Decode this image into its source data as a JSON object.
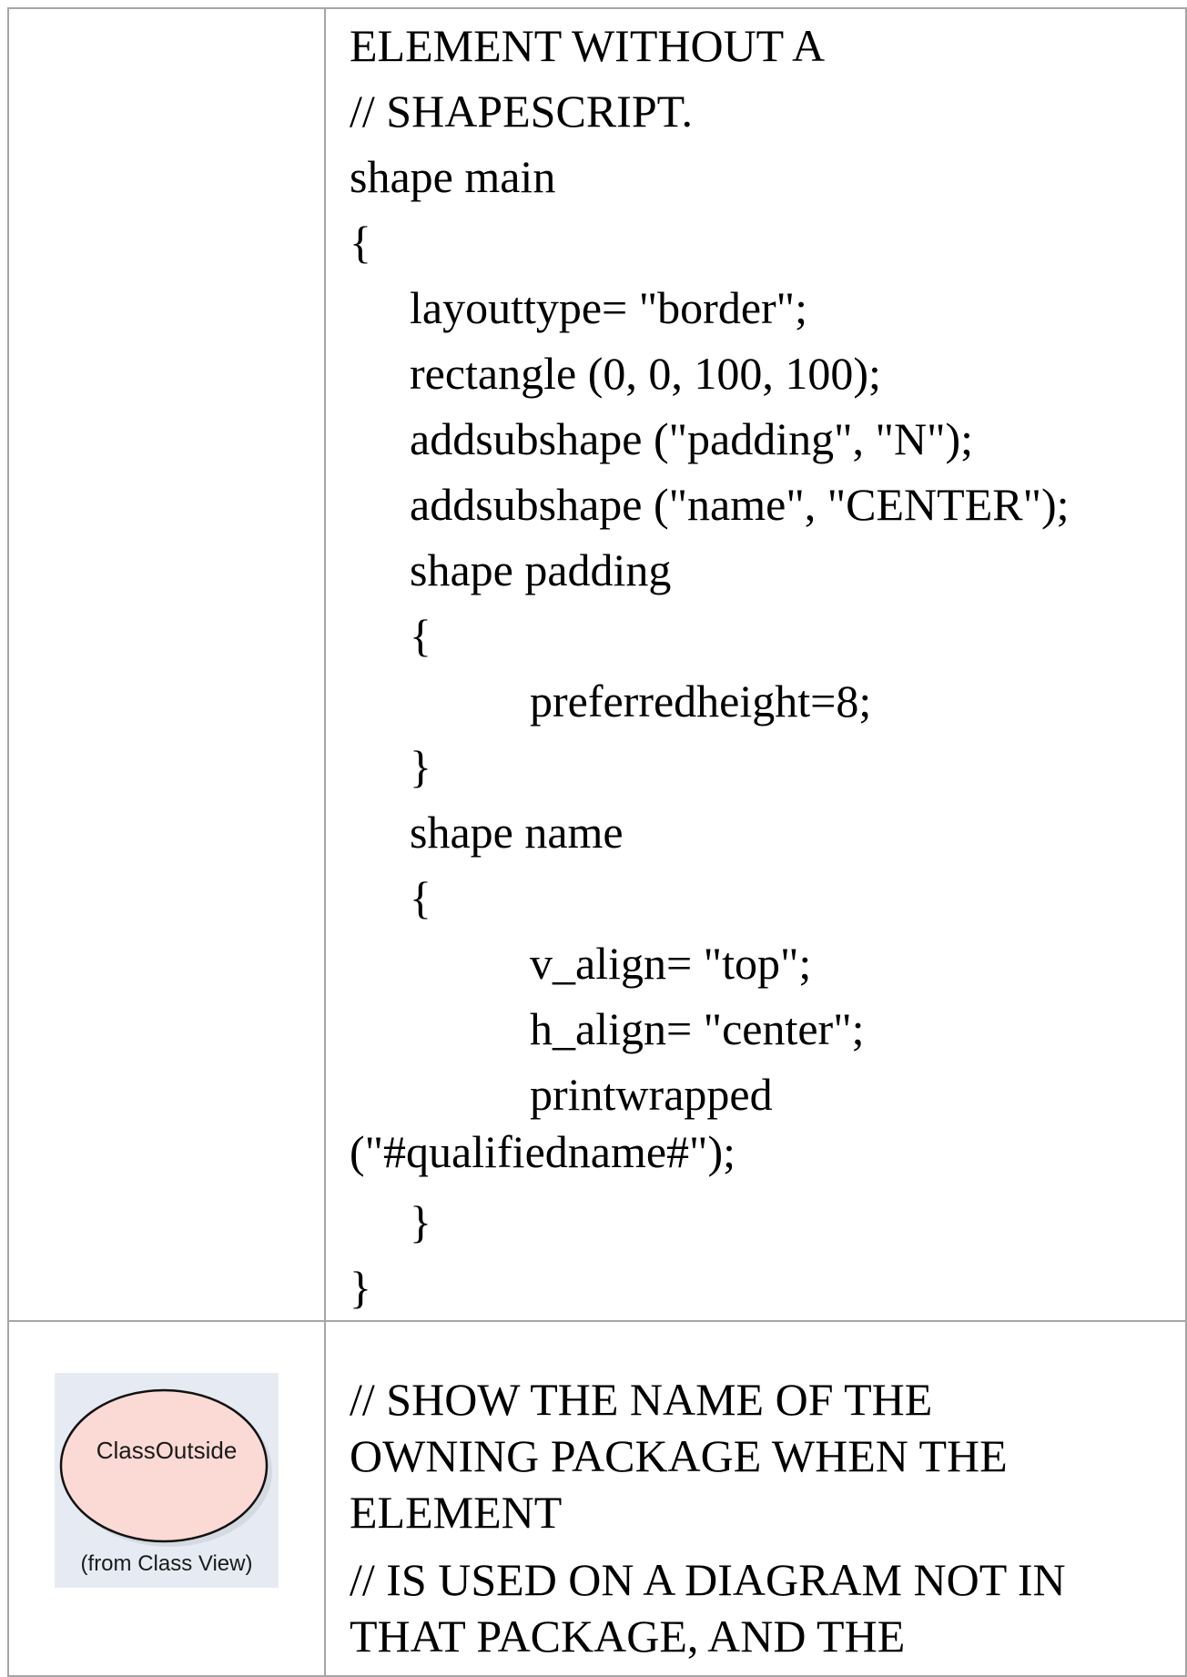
{
  "code_lines": [
    "ELEMENT WITHOUT A",
    "// SHAPESCRIPT.",
    "shape main",
    "{",
    "layouttype= \"border\";",
    "rectangle (0, 0, 100, 100);",
    "addsubshape (\"padding\", \"N\");",
    "addsubshape (\"name\", \"CENTER\");",
    "shape padding",
    "{",
    "preferredheight=8;",
    "}",
    "shape name",
    "{",
    "v_align= \"top\";",
    "h_align= \"center\";",
    "printwrapped",
    "(\"#qualifiedname#\");",
    "}",
    "}"
  ],
  "diagram_element": {
    "name": "ClassOutside",
    "origin": "(from Class View)",
    "fill_color": "#fbdad5",
    "background_color": "#e6ebf3"
  },
  "comment_lines": [
    "// SHOW THE NAME OF THE",
    "OWNING PACKAGE WHEN THE",
    "ELEMENT",
    "// IS USED ON A DIAGRAM NOT IN",
    "THAT PACKAGE, AND THE"
  ]
}
